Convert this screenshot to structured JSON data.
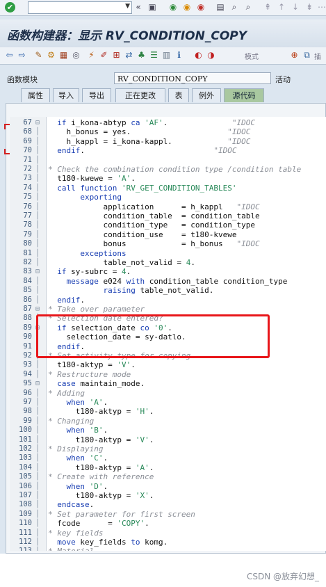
{
  "toolbar": {
    "command_field": "",
    "dropdown_glyph": "▼",
    "back_glyph": "«",
    "save_icon": "floppy-icon",
    "icons": [
      "save-icon",
      "back-icon",
      "exit-icon",
      "cancel-icon",
      "print-icon",
      "find-icon",
      "find-next-icon",
      "first-page-icon",
      "prev-page-icon",
      "next-page-icon",
      "last-page-icon"
    ]
  },
  "title": "函数构建器：显示 RV_CONDITION_COPY",
  "app_toolbar": {
    "mode_label": "模式",
    "insert_label": "插"
  },
  "module": {
    "label": "函数模块",
    "value": "RV_CONDITION_COPY",
    "status": "活动"
  },
  "tabs": [
    "属性",
    "导入",
    "导出",
    "正在更改",
    "表",
    "例外",
    "源代码"
  ],
  "active_tab": "源代码",
  "code_lines": [
    {
      "n": "67",
      "f": "⊟",
      "t": [
        [
          "kw",
          "  if "
        ],
        [
          "pl",
          "i_kona-abtyp "
        ],
        [
          "kw",
          "ca "
        ],
        [
          "str",
          "'AF'"
        ],
        [
          "pl",
          "."
        ],
        [
          "cm",
          "              \"IDOC"
        ]
      ]
    },
    {
      "n": "68",
      "f": "",
      "t": [
        [
          "pl",
          "    h_bonus = yes."
        ],
        [
          "cm",
          "                     \"IDOC"
        ]
      ]
    },
    {
      "n": "69",
      "f": "",
      "t": [
        [
          "pl",
          "    h_kappl = i_kona-kappl."
        ],
        [
          "cm",
          "            \"IDOC"
        ]
      ]
    },
    {
      "n": "70",
      "f": "",
      "t": [
        [
          "kw",
          "  endif"
        ],
        [
          "pl",
          "."
        ],
        [
          "cm",
          "                            \"IDOC"
        ]
      ]
    },
    {
      "n": "71",
      "f": "",
      "t": [
        [
          "pl",
          ""
        ]
      ]
    },
    {
      "n": "72",
      "f": "",
      "t": [
        [
          "cm",
          "* Check the combination condition type /condition table"
        ]
      ]
    },
    {
      "n": "73",
      "f": "",
      "t": [
        [
          "pl",
          "  t180-kwewe = "
        ],
        [
          "str",
          "'A'"
        ],
        [
          "pl",
          "."
        ]
      ]
    },
    {
      "n": "74",
      "f": "",
      "t": [
        [
          "kw",
          "  call function "
        ],
        [
          "str",
          "'RV_GET_CONDITION_TABLES'"
        ]
      ]
    },
    {
      "n": "75",
      "f": "",
      "t": [
        [
          "kw",
          "       exporting"
        ]
      ]
    },
    {
      "n": "76",
      "f": "",
      "t": [
        [
          "pl",
          "            application      = h_kappl   "
        ],
        [
          "cm",
          "\"IDOC"
        ]
      ]
    },
    {
      "n": "77",
      "f": "",
      "t": [
        [
          "pl",
          "            condition_table  = condition_table"
        ]
      ]
    },
    {
      "n": "78",
      "f": "",
      "t": [
        [
          "pl",
          "            condition_type   = condition_type"
        ]
      ]
    },
    {
      "n": "79",
      "f": "",
      "t": [
        [
          "pl",
          "            condition_use    = t180-kvewe"
        ]
      ]
    },
    {
      "n": "80",
      "f": "",
      "t": [
        [
          "pl",
          "            bonus            = h_bonus   "
        ],
        [
          "cm",
          "\"IDOC"
        ]
      ]
    },
    {
      "n": "81",
      "f": "",
      "t": [
        [
          "kw",
          "       exceptions"
        ]
      ]
    },
    {
      "n": "82",
      "f": "",
      "t": [
        [
          "pl",
          "            table_not_valid = "
        ],
        [
          "str",
          "4"
        ],
        [
          "pl",
          "."
        ]
      ]
    },
    {
      "n": "83",
      "f": "⊟",
      "t": [
        [
          "kw",
          "  if "
        ],
        [
          "pl",
          "sy-subrc = "
        ],
        [
          "str",
          "4"
        ],
        [
          "pl",
          "."
        ]
      ]
    },
    {
      "n": "84",
      "f": "",
      "t": [
        [
          "kw",
          "    message "
        ],
        [
          "pl",
          "e024 "
        ],
        [
          "kw",
          "with "
        ],
        [
          "pl",
          "condition_table condition_type"
        ]
      ]
    },
    {
      "n": "85",
      "f": "",
      "t": [
        [
          "kw",
          "            raising "
        ],
        [
          "pl",
          "table_not_valid."
        ]
      ]
    },
    {
      "n": "86",
      "f": "",
      "t": [
        [
          "kw",
          "  endif"
        ],
        [
          "pl",
          "."
        ]
      ]
    },
    {
      "n": "87",
      "f": "⊟",
      "t": [
        [
          "cm",
          "* Take over parameter"
        ]
      ]
    },
    {
      "n": "88",
      "f": "",
      "t": [
        [
          "cm",
          "* Selection date entered?"
        ]
      ]
    },
    {
      "n": "89",
      "f": "⊟",
      "t": [
        [
          "kw",
          "  if "
        ],
        [
          "pl",
          "selection_date "
        ],
        [
          "kw",
          "co "
        ],
        [
          "str",
          "'0'"
        ],
        [
          "pl",
          "."
        ]
      ]
    },
    {
      "n": "90",
      "f": "",
      "t": [
        [
          "pl",
          "    selection_date = sy-datlo."
        ]
      ]
    },
    {
      "n": "91",
      "f": "",
      "t": [
        [
          "kw",
          "  endif"
        ],
        [
          "pl",
          "."
        ]
      ]
    },
    {
      "n": "92",
      "f": "",
      "t": [
        [
          "cm",
          "* Set activity type for copying"
        ]
      ]
    },
    {
      "n": "93",
      "f": "",
      "t": [
        [
          "pl",
          "  t180-aktyp = "
        ],
        [
          "str",
          "'V'"
        ],
        [
          "pl",
          "."
        ]
      ]
    },
    {
      "n": "94",
      "f": "",
      "t": [
        [
          "cm",
          "* Restructure mode"
        ]
      ]
    },
    {
      "n": "95",
      "f": "⊟",
      "t": [
        [
          "kw",
          "  case "
        ],
        [
          "pl",
          "maintain_mode."
        ]
      ]
    },
    {
      "n": "96",
      "f": "",
      "t": [
        [
          "cm",
          "* Adding"
        ]
      ]
    },
    {
      "n": "97",
      "f": "",
      "t": [
        [
          "kw",
          "    when "
        ],
        [
          "str",
          "'A'"
        ],
        [
          "pl",
          "."
        ]
      ]
    },
    {
      "n": "98",
      "f": "",
      "t": [
        [
          "pl",
          "      t180-aktyp = "
        ],
        [
          "str",
          "'H'"
        ],
        [
          "pl",
          "."
        ]
      ]
    },
    {
      "n": "99",
      "f": "",
      "t": [
        [
          "cm",
          "* Changing"
        ]
      ]
    },
    {
      "n": "100",
      "f": "",
      "t": [
        [
          "kw",
          "    when "
        ],
        [
          "str",
          "'B'"
        ],
        [
          "pl",
          "."
        ]
      ]
    },
    {
      "n": "101",
      "f": "",
      "t": [
        [
          "pl",
          "      t180-aktyp = "
        ],
        [
          "str",
          "'V'"
        ],
        [
          "pl",
          "."
        ]
      ]
    },
    {
      "n": "102",
      "f": "",
      "t": [
        [
          "cm",
          "* Displaying"
        ]
      ]
    },
    {
      "n": "103",
      "f": "",
      "t": [
        [
          "kw",
          "    when "
        ],
        [
          "str",
          "'C'"
        ],
        [
          "pl",
          "."
        ]
      ]
    },
    {
      "n": "104",
      "f": "",
      "t": [
        [
          "pl",
          "      t180-aktyp = "
        ],
        [
          "str",
          "'A'"
        ],
        [
          "pl",
          "."
        ]
      ]
    },
    {
      "n": "105",
      "f": "",
      "t": [
        [
          "cm",
          "* Create with reference"
        ]
      ]
    },
    {
      "n": "106",
      "f": "",
      "t": [
        [
          "kw",
          "    when "
        ],
        [
          "str",
          "'D'"
        ],
        [
          "pl",
          "."
        ]
      ]
    },
    {
      "n": "107",
      "f": "",
      "t": [
        [
          "pl",
          "      t180-aktyp = "
        ],
        [
          "str",
          "'X'"
        ],
        [
          "pl",
          "."
        ]
      ]
    },
    {
      "n": "108",
      "f": "",
      "t": [
        [
          "kw",
          "  endcase"
        ],
        [
          "pl",
          "."
        ]
      ]
    },
    {
      "n": "109",
      "f": "",
      "t": [
        [
          "cm",
          "* Set parameter for first screen"
        ]
      ]
    },
    {
      "n": "110",
      "f": "",
      "t": [
        [
          "pl",
          "  fcode      = "
        ],
        [
          "str",
          "'COPY'"
        ],
        [
          "pl",
          "."
        ]
      ]
    },
    {
      "n": "111",
      "f": "",
      "t": [
        [
          "cm",
          "* key fields"
        ]
      ]
    },
    {
      "n": "112",
      "f": "",
      "t": [
        [
          "kw",
          "  move "
        ],
        [
          "pl",
          "key_fields "
        ],
        [
          "kw",
          "to "
        ],
        [
          "pl",
          "komg."
        ]
      ]
    },
    {
      "n": "113",
      "f": "",
      "t": [
        [
          "cm",
          "* Material"
        ]
      ]
    }
  ],
  "watermark": "CSDN @放弃幻想_",
  "colors": {
    "highlight_box": "#e8161a",
    "keyword": "#1a3fb3",
    "string": "#2a8a5a",
    "comment": "#8a8e96",
    "active_tab": "#a9c8a0"
  }
}
